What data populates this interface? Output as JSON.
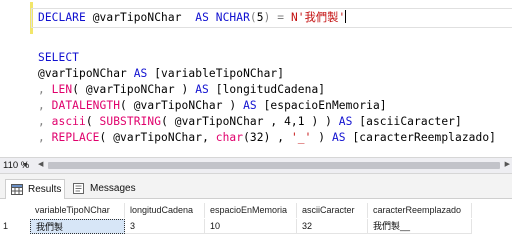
{
  "editor": {
    "line1": {
      "kw_declare": "DECLARE",
      "var": " @varTipoNChar  ",
      "kw_as": "AS",
      "kw_type": " NCHAR",
      "paren_open": "(",
      "num": "5",
      "paren_close": ")",
      "eq": " = ",
      "string": "N'我們製'"
    },
    "select_kw": "SELECT",
    "line_var": "@varTipoNChar",
    "line_var_as": " AS",
    "line_var_alias": " [variableTipoNChar]",
    "line_len": {
      "comma": ", ",
      "fn": "LEN",
      "mid": "( @varTipoNChar )",
      "as": " AS",
      "alias": " [longitudCadena]"
    },
    "line_datalength": {
      "comma": ", ",
      "fn": "DATALENGTH",
      "mid": "( @varTipoNChar )",
      "as": " AS",
      "alias": " [espacioEnMemoria]"
    },
    "line_ascii": {
      "comma": ", ",
      "fn1": "ascii",
      "p1": "( ",
      "fn2": "SUBSTRING",
      "mid": "( @varTipoNChar , 4,1 ) )",
      "as": " AS",
      "alias": " [asciiCaracter]"
    },
    "line_replace": {
      "comma": ", ",
      "fn": "REPLACE",
      "p1": "( @varTipoNChar, ",
      "fn2": "char",
      "p2": "(32) , ",
      "str": "'_'",
      "p3": " ) ",
      "as": "AS",
      "alias": " [caracterReemplazado]"
    }
  },
  "zoom": {
    "value": "110 %"
  },
  "tabs": {
    "results": "Results",
    "messages": "Messages"
  },
  "grid": {
    "columns": [
      "variableTipoNChar",
      "longitudCadena",
      "espacioEnMemoria",
      "asciiCaracter",
      "caracterReemplazado"
    ],
    "rows": [
      {
        "num": "1",
        "cells": [
          "我們製",
          "3",
          "10",
          "32",
          "我們製__"
        ]
      }
    ]
  },
  "colors": {
    "keyword": "#1010d0",
    "function": "#e0006c",
    "string": "#c41010",
    "selection": "#d7e6f7"
  }
}
